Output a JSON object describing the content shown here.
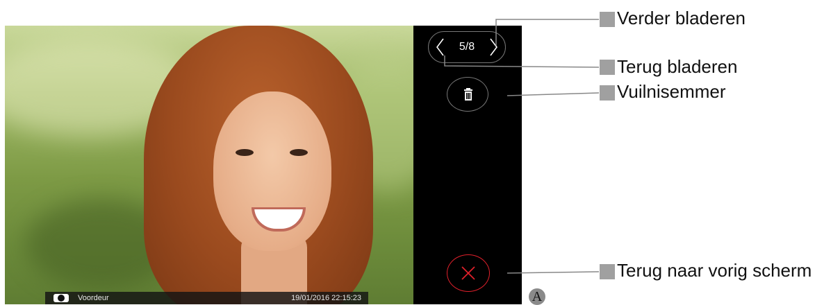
{
  "caption": {
    "camera_icon": "camera-icon",
    "location": "Voordeur",
    "datetime": "19/01/2016  22:15:23"
  },
  "panel": {
    "counter": "5/8",
    "prev_icon": "chevron-left-icon",
    "next_icon": "chevron-right-icon",
    "trash_icon": "trash-icon",
    "close_icon": "close-icon",
    "close_color": "#e0202b",
    "panel_color": "#000000"
  },
  "callouts": {
    "next": "Verder bladeren",
    "prev": "Terug bladeren",
    "trash": "Vuilnisemmer",
    "close": "Terug naar vorig scherm",
    "marker_color": "#a0a0a0"
  },
  "figure_marker": "A"
}
